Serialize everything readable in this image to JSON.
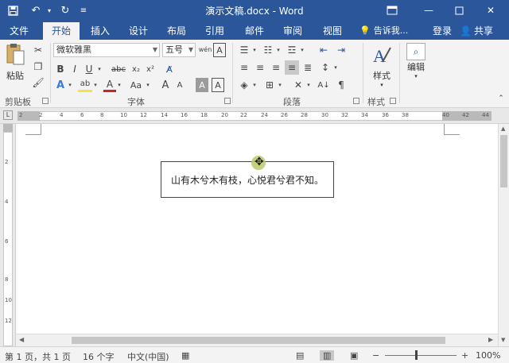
{
  "window": {
    "title": "演示文稿.docx - Word",
    "controls": [
      "ribbon-display-icon",
      "minimize-icon",
      "maximize-icon",
      "close-icon"
    ]
  },
  "quick_access": {
    "icons": [
      "save-icon",
      "undo-icon",
      "redo-icon",
      "customize-icon"
    ]
  },
  "tabs": [
    "文件",
    "开始",
    "插入",
    "设计",
    "布局",
    "引用",
    "邮件",
    "审阅",
    "视图"
  ],
  "active_tab": "开始",
  "tell_me": "告诉我...",
  "login": "登录",
  "share": "共享",
  "ribbon": {
    "clipboard": {
      "label": "剪贴板",
      "paste_label": "粘贴"
    },
    "font": {
      "label": "字体",
      "font_name": "微软雅黑",
      "font_size": "五号",
      "wen_glyph": "wén",
      "bold": "B",
      "italic": "I",
      "underline": "U",
      "strike": "abc",
      "subscript": "x₂",
      "superscript": "x²",
      "font_color": "A",
      "change_case": "Aa",
      "grow": "A",
      "shrink": "A",
      "char_shade": "A",
      "char_border": "A",
      "text_effect": "A"
    },
    "paragraph": {
      "label": "段落"
    },
    "styles": {
      "label": "样式",
      "button_label": "样式"
    },
    "editing": {
      "button_label": "编辑"
    }
  },
  "ruler": {
    "corner": "L",
    "ticks": [
      "2",
      "2",
      "4",
      "6",
      "8",
      "10",
      "12",
      "14",
      "16",
      "18",
      "20",
      "22",
      "24",
      "26",
      "28",
      "30",
      "32",
      "34",
      "36",
      "38",
      "40",
      "42",
      "44"
    ]
  },
  "vruler": {
    "ticks": [
      "2",
      "4",
      "6",
      "8",
      "10",
      "12"
    ]
  },
  "document": {
    "textbox_text": "山有木兮木有枝，心悦君兮君不知。"
  },
  "status": {
    "page": "第 1 页，共 1 页",
    "words": "16 个字",
    "language": "中文(中国)",
    "zoom": "100%",
    "zoom_minus": "−",
    "zoom_plus": "+"
  },
  "colors": {
    "title_bar": "#2b579a",
    "ribbon_bg": "#f3f3f3",
    "highlight_yellow": "#f5e342",
    "font_red": "#d42020"
  }
}
